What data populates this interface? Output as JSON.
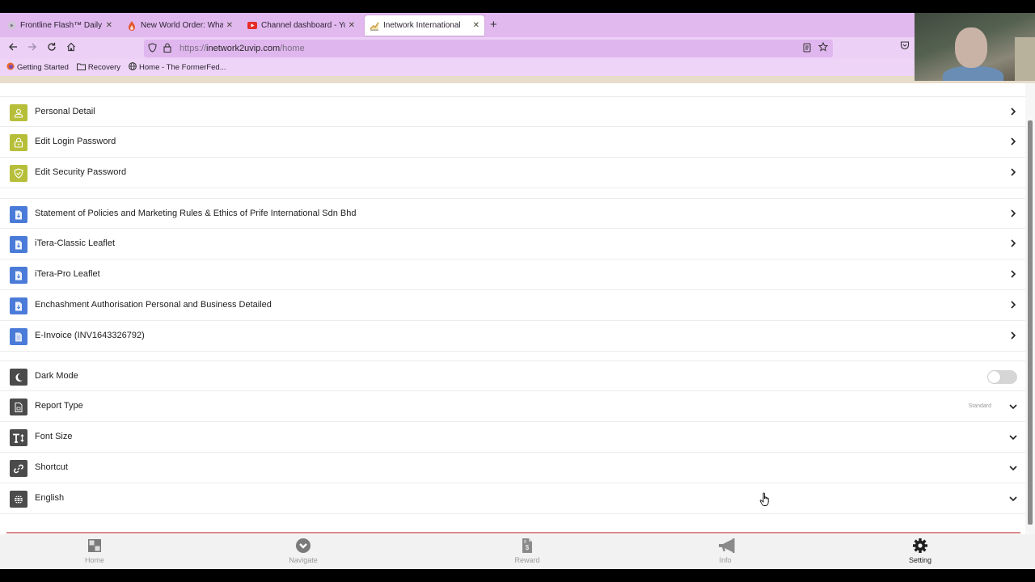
{
  "browser": {
    "tabs": [
      {
        "title": "Frontline Flash™ Daily Dose",
        "favicon": "play-icon",
        "active": false
      },
      {
        "title": "New World Order: What is",
        "favicon": "flame-icon",
        "active": false
      },
      {
        "title": "Channel dashboard - YouTube",
        "favicon": "youtube-icon",
        "active": false
      },
      {
        "title": "Inetwork International",
        "favicon": "chart-icon",
        "active": true
      }
    ],
    "url_prefix": "https://",
    "url_host": "inetwork2uvip.com",
    "url_path": "/home",
    "bookmarks": [
      {
        "label": "Getting Started",
        "icon": "firefox-icon"
      },
      {
        "label": "Recovery",
        "icon": "folder-icon"
      },
      {
        "label": "Home - The FormerFed...",
        "icon": "globe-icon"
      }
    ]
  },
  "settings": {
    "account_items": [
      {
        "label": "Personal Detail",
        "icon": "user-icon"
      },
      {
        "label": "Edit Login Password",
        "icon": "lock-icon"
      },
      {
        "label": "Edit Security Password",
        "icon": "shield-check-icon"
      }
    ],
    "document_items": [
      {
        "label": "Statement of Policies and Marketing Rules & Ethics of Prife International Sdn Bhd",
        "icon": "file-download-icon"
      },
      {
        "label": "iTera-Classic Leaflet",
        "icon": "file-download-icon"
      },
      {
        "label": "iTera-Pro Leaflet",
        "icon": "file-download-icon"
      },
      {
        "label": "Enchashment Authorisation Personal and Business Detailed",
        "icon": "file-download-icon"
      },
      {
        "label": "E-Invoice (INV1643326792)",
        "icon": "file-text-icon"
      }
    ],
    "preference_items": [
      {
        "label": "Dark Mode",
        "icon": "moon-icon",
        "toggle": false
      },
      {
        "label": "Report Type",
        "icon": "report-icon",
        "value": "Standard"
      },
      {
        "label": "Font Size",
        "icon": "text-size-icon"
      },
      {
        "label": "Shortcut",
        "icon": "link-icon"
      },
      {
        "label": "English",
        "icon": "globe-icon"
      }
    ]
  },
  "bottom_nav": [
    {
      "label": "Home",
      "icon": "home-grid-icon",
      "active": false
    },
    {
      "label": "Navigate",
      "icon": "navigate-icon",
      "active": false
    },
    {
      "label": "Reward",
      "icon": "reward-icon",
      "active": false
    },
    {
      "label": "Info",
      "icon": "megaphone-icon",
      "active": false
    },
    {
      "label": "Setting",
      "icon": "gear-icon",
      "active": true
    }
  ],
  "colors": {
    "account_icon_bg": "#b7bf3a",
    "document_icon_bg": "#4b7bd8",
    "preference_icon_bg": "#4b4b4b",
    "browser_chrome": "#e8c6f2"
  }
}
